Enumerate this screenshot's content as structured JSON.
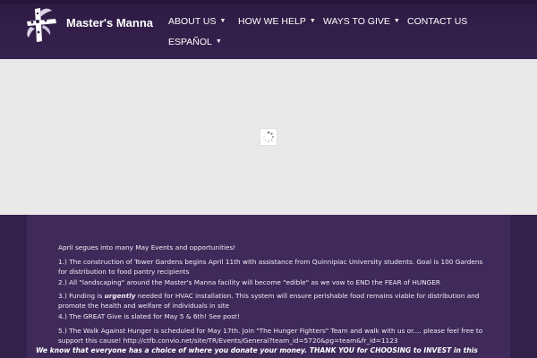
{
  "brand": {
    "name": "Master's Manna",
    "logo_icon": "cross-leaf-logo-icon",
    "header_color": "#2e1b44",
    "content_color": "#3f2a5a"
  },
  "nav": {
    "items": [
      {
        "label": "ABOUT US",
        "dropdown": true
      },
      {
        "label": "HOW WE HELP",
        "dropdown": true
      },
      {
        "label": "WAYS TO GIVE",
        "dropdown": true
      },
      {
        "label": "CONTACT US",
        "dropdown": false
      },
      {
        "label": "ESPAÑOL",
        "dropdown": true
      }
    ],
    "caret_icon": "caret-down-icon"
  },
  "slider": {
    "loader_icon": "spinner-icon"
  },
  "content": {
    "intro": "April segues into many May Events and opportunities!",
    "item1": "1.) The construction of Tower Gardens begins April 11th with assistance from Quinnipiac University students. Goal is 100 Gardens for distribution to food pantry recipients",
    "item2": "2.) All \"landscaping\" around the Master's Manna facility will become \"edible\" as we vow to END the FEAR of HUNGER",
    "item3_a": "3.) Funding is ",
    "item3_em": "urgently",
    "item3_b": " needed for HVAC installation. This system will ensure perishable food remains viable for distribution and promote the health and welfare of individuals in site",
    "item4": "4.) The GREAT Give is slated for May 5 & 6th! See post!",
    "item5": "5.) The Walk Against Hunger is scheduled for May 17th. Join \"The Hunger Fighters\" Team and walk with us or.... please feel free to support this cause! http://ctfb.convio.net/site/TR/Events/General?team_id=5720&pg=team&fr_id=1123",
    "closing": "We know that everyone has a choice of where you donate your money. THANK YOU for CHOOSING to INVEST in this"
  }
}
